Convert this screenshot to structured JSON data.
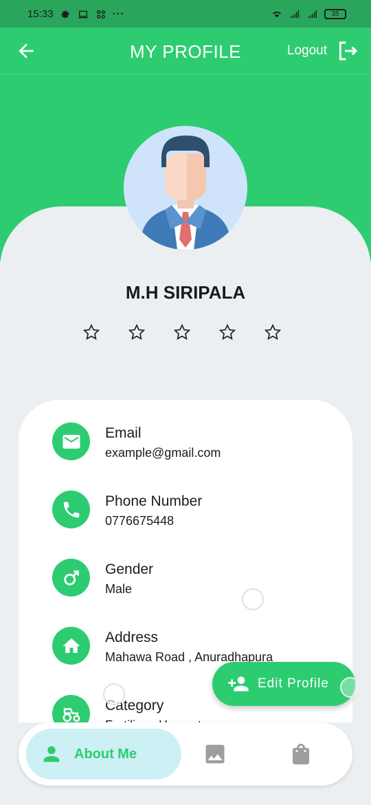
{
  "status_bar": {
    "time": "15:33",
    "battery": "35"
  },
  "topbar": {
    "title": "MY PROFILE",
    "logout_label": "Logout"
  },
  "profile": {
    "name": "M.H SIRIPALA",
    "rating": 0,
    "max_rating": 5
  },
  "info": [
    {
      "icon": "email-icon",
      "label": "Email",
      "value": "example@gmail.com"
    },
    {
      "icon": "phone-icon",
      "label": "Phone Number",
      "value": "0776675448"
    },
    {
      "icon": "gender-male-icon",
      "label": "Gender",
      "value": "Male"
    },
    {
      "icon": "home-icon",
      "label": "Address",
      "value": "Mahawa Road , Anuradhapura"
    },
    {
      "icon": "tractor-icon",
      "label": "Category",
      "value": "Fertilizer, Harvest"
    }
  ],
  "fab": {
    "label": "Edit Profile",
    "icon": "person-add-icon"
  },
  "bottom_nav": {
    "active_label": "About Me",
    "items": [
      "person-icon",
      "image-icon",
      "shopping-bag-icon"
    ]
  },
  "colors": {
    "primary": "#2ecc71",
    "background": "#eceff1",
    "active_tab": "#cdf0f4"
  }
}
